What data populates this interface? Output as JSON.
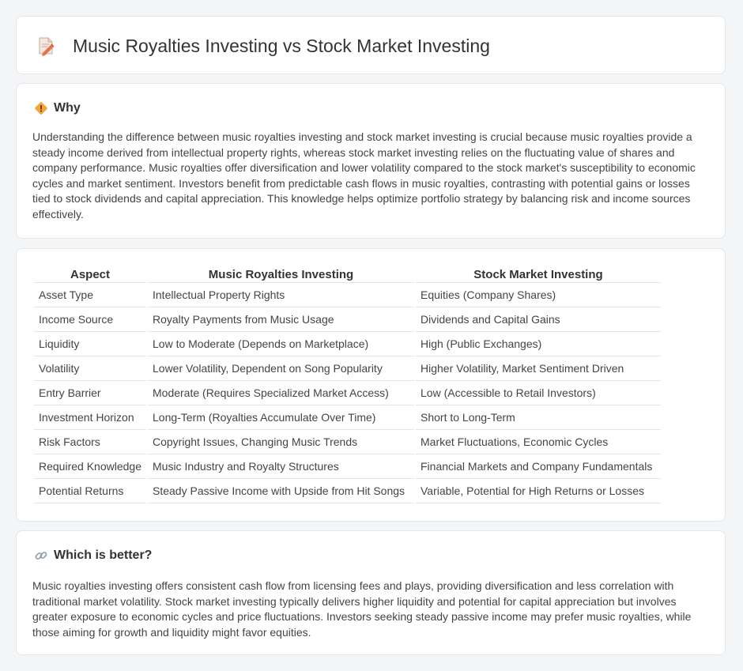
{
  "header": {
    "title": "Music Royalties Investing vs Stock Market Investing",
    "icon": "document-edit-icon"
  },
  "why": {
    "heading": "Why",
    "icon": "diamond-warning-icon",
    "text": "Understanding the difference between music royalties investing and stock market investing is crucial because music royalties provide a steady income derived from intellectual property rights, whereas stock market investing relies on the fluctuating value of shares and company performance. Music royalties offer diversification and lower volatility compared to the stock market's susceptibility to economic cycles and market sentiment. Investors benefit from predictable cash flows in music royalties, contrasting with potential gains or losses tied to stock dividends and capital appreciation. This knowledge helps optimize portfolio strategy by balancing risk and income sources effectively."
  },
  "comparison": {
    "headers": [
      "Aspect",
      "Music Royalties Investing",
      "Stock Market Investing"
    ],
    "rows": [
      [
        "Asset Type",
        "Intellectual Property Rights",
        "Equities (Company Shares)"
      ],
      [
        "Income Source",
        "Royalty Payments from Music Usage",
        "Dividends and Capital Gains"
      ],
      [
        "Liquidity",
        "Low to Moderate (Depends on Marketplace)",
        "High (Public Exchanges)"
      ],
      [
        "Volatility",
        "Lower Volatility, Dependent on Song Popularity",
        "Higher Volatility, Market Sentiment Driven"
      ],
      [
        "Entry Barrier",
        "Moderate (Requires Specialized Market Access)",
        "Low (Accessible to Retail Investors)"
      ],
      [
        "Investment Horizon",
        "Long-Term (Royalties Accumulate Over Time)",
        "Short to Long-Term"
      ],
      [
        "Risk Factors",
        "Copyright Issues, Changing Music Trends",
        "Market Fluctuations, Economic Cycles"
      ],
      [
        "Required Knowledge",
        "Music Industry and Royalty Structures",
        "Financial Markets and Company Fundamentals"
      ],
      [
        "Potential Returns",
        "Steady Passive Income with Upside from Hit Songs",
        "Variable, Potential for High Returns or Losses"
      ]
    ]
  },
  "better": {
    "heading": "Which is better?",
    "icon": "link-icon",
    "text": "Music royalties investing offers consistent cash flow from licensing fees and plays, providing diversification and less correlation with traditional market volatility. Stock market investing typically delivers higher liquidity and potential for capital appreciation but involves greater exposure to economic cycles and price fluctuations. Investors seeking steady passive income may prefer music royalties, while those aiming for growth and liquidity might favor equities."
  }
}
